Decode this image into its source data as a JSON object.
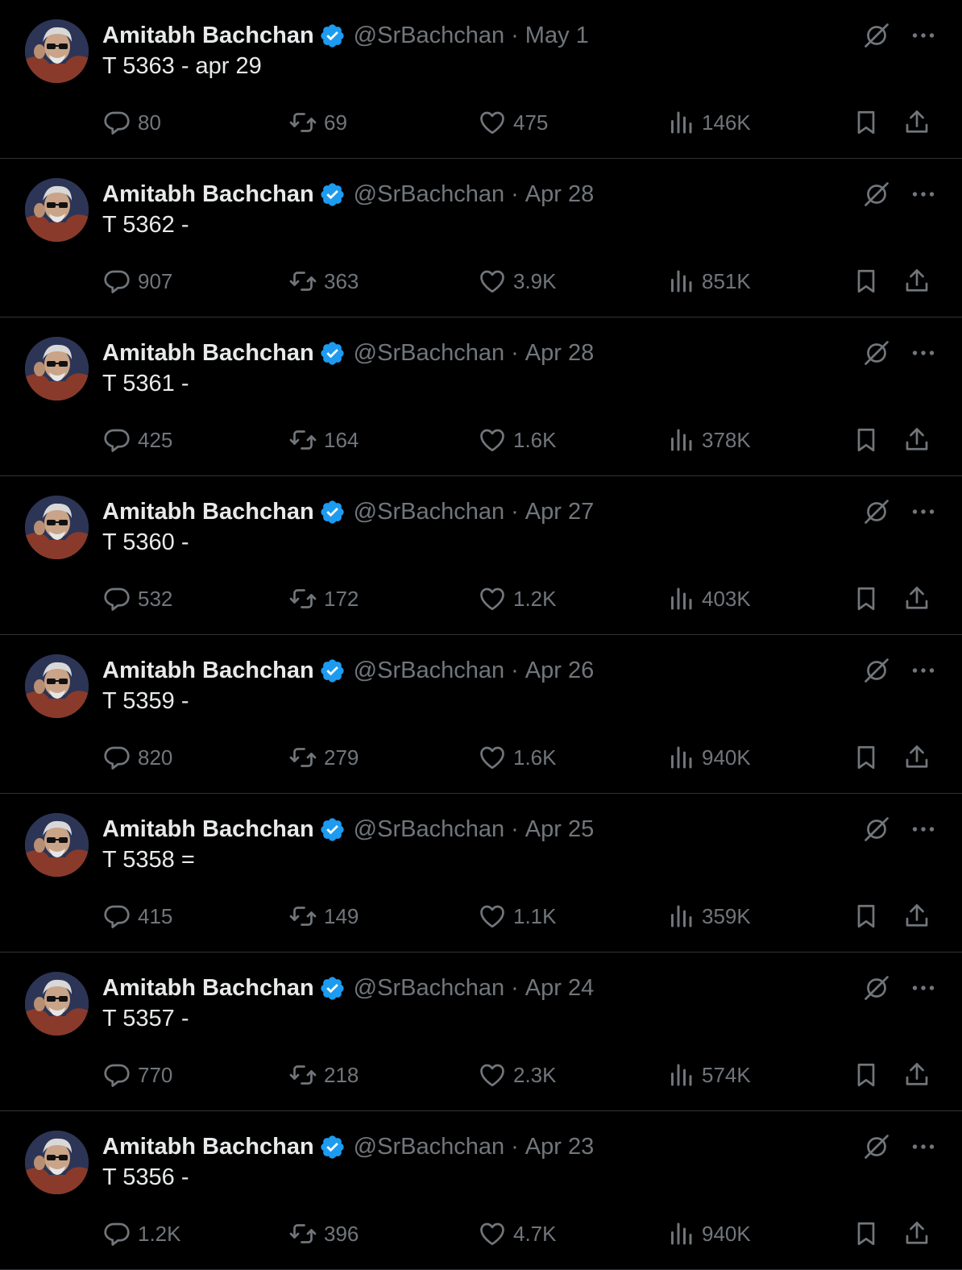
{
  "colors": {
    "background": "#000000",
    "text_primary": "#e7e9ea",
    "text_secondary": "#71767b",
    "divider": "#2f3336",
    "verified_blue": "#1d9bf0"
  },
  "icons": {
    "reply": "reply-icon",
    "retweet": "retweet-icon",
    "like": "heart-icon",
    "views": "views-icon",
    "bookmark": "bookmark-icon",
    "share": "share-icon",
    "grok": "grok-icon",
    "more": "more-icon",
    "verified": "verified-badge-icon"
  },
  "tweets": [
    {
      "name": "Amitabh Bachchan",
      "handle": "@SrBachchan",
      "separator": "·",
      "date": "May 1",
      "text": "T 5363 - apr 29",
      "replies": "80",
      "retweets": "69",
      "likes": "475",
      "views": "146K"
    },
    {
      "name": "Amitabh Bachchan",
      "handle": "@SrBachchan",
      "separator": "·",
      "date": "Apr 28",
      "text": "T 5362 -",
      "replies": "907",
      "retweets": "363",
      "likes": "3.9K",
      "views": "851K"
    },
    {
      "name": "Amitabh Bachchan",
      "handle": "@SrBachchan",
      "separator": "·",
      "date": "Apr 28",
      "text": "T 5361 -",
      "replies": "425",
      "retweets": "164",
      "likes": "1.6K",
      "views": "378K"
    },
    {
      "name": "Amitabh Bachchan",
      "handle": "@SrBachchan",
      "separator": "·",
      "date": "Apr 27",
      "text": "T 5360 -",
      "replies": "532",
      "retweets": "172",
      "likes": "1.2K",
      "views": "403K"
    },
    {
      "name": "Amitabh Bachchan",
      "handle": "@SrBachchan",
      "separator": "·",
      "date": "Apr 26",
      "text": "T 5359 -",
      "replies": "820",
      "retweets": "279",
      "likes": "1.6K",
      "views": "940K"
    },
    {
      "name": "Amitabh Bachchan",
      "handle": "@SrBachchan",
      "separator": "·",
      "date": "Apr 25",
      "text": "T 5358 =",
      "replies": "415",
      "retweets": "149",
      "likes": "1.1K",
      "views": "359K"
    },
    {
      "name": "Amitabh Bachchan",
      "handle": "@SrBachchan",
      "separator": "·",
      "date": "Apr 24",
      "text": "T 5357 -",
      "replies": "770",
      "retweets": "218",
      "likes": "2.3K",
      "views": "574K"
    },
    {
      "name": "Amitabh Bachchan",
      "handle": "@SrBachchan",
      "separator": "·",
      "date": "Apr 23",
      "text": "T 5356 -",
      "replies": "1.2K",
      "retweets": "396",
      "likes": "4.7K",
      "views": "940K"
    }
  ]
}
